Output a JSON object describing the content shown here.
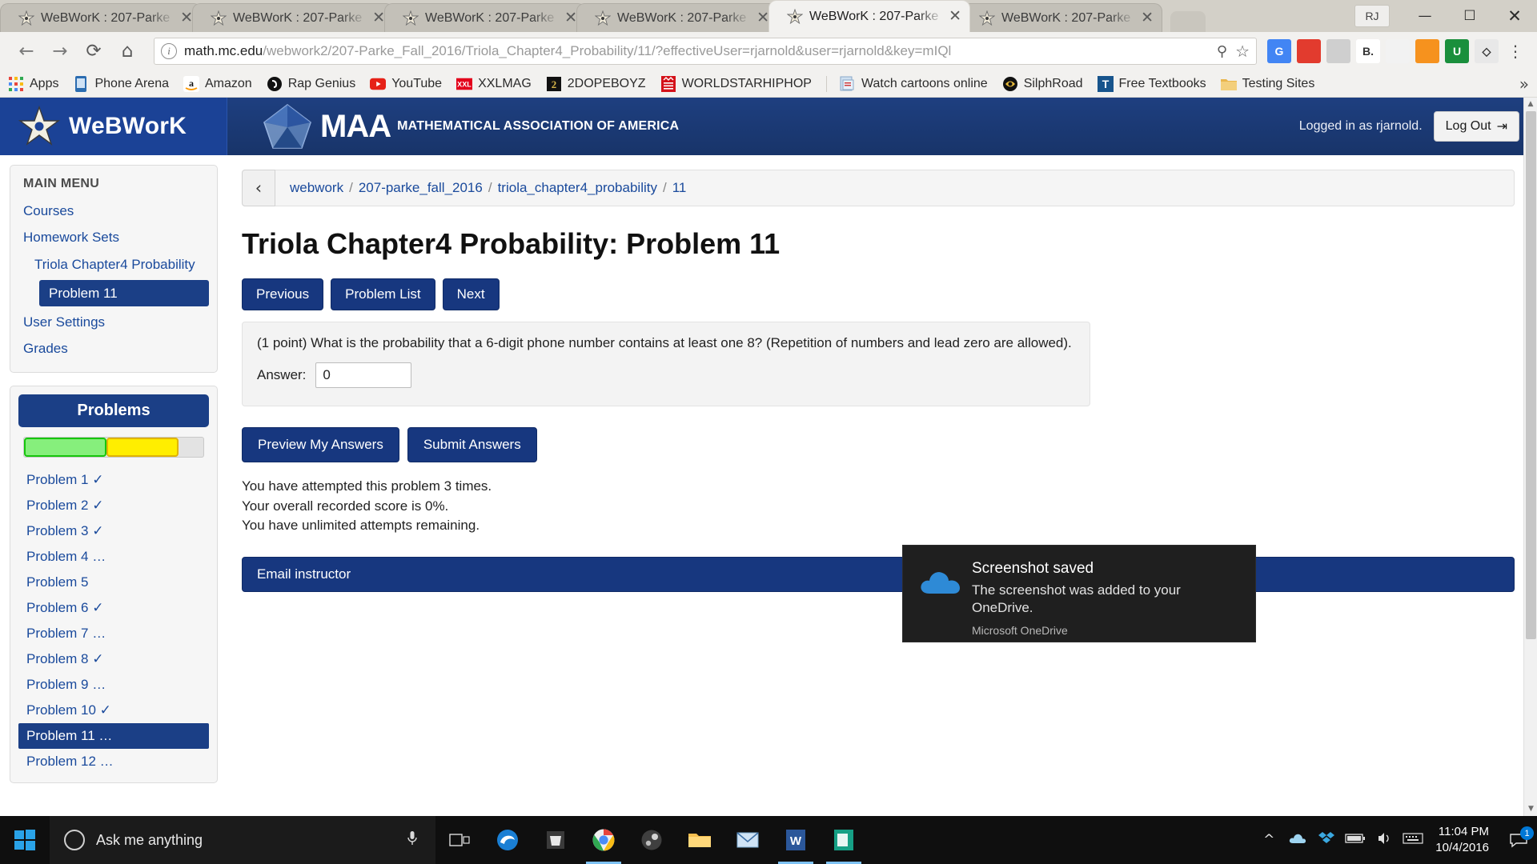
{
  "browser": {
    "tabs": [
      {
        "title": "WeBWorK : 207-Parke",
        "active": false
      },
      {
        "title": "WeBWorK : 207-Parke",
        "active": false
      },
      {
        "title": "WeBWorK : 207-Parke",
        "active": false
      },
      {
        "title": "WeBWorK : 207-Parke",
        "active": false
      },
      {
        "title": "WeBWorK : 207-Parke",
        "active": true
      },
      {
        "title": "WeBWorK : 207-Parke",
        "active": false
      }
    ],
    "close_glyph": "✕",
    "nav": {
      "back": "←",
      "forward": "→",
      "reload": "⟳",
      "home": "⌂"
    },
    "omnibox": {
      "host": "math.mc.edu",
      "path": "/webwork2/207-Parke_Fall_2016/Triola_Chapter4_Probability/11/?effectiveUser=rjarnold&user=rjarnold&key=mIQl",
      "info_glyph": "i",
      "zoom_glyph": "⚲",
      "star_glyph": "☆"
    },
    "extensions": [
      {
        "name": "google-translate-extension",
        "label": "G",
        "color": "#4285f4"
      },
      {
        "name": "adblock-extension",
        "label": "",
        "color": "#e23b2e"
      },
      {
        "name": "grey-extension",
        "label": "",
        "color": "#cfcfcf"
      },
      {
        "name": "bitly-extension",
        "label": "B.",
        "color": "#ffffff"
      },
      {
        "name": "pocket-extension",
        "label": "",
        "color": "#f2f2f2"
      },
      {
        "name": "orange-extension",
        "label": "",
        "color": "#f6921e"
      },
      {
        "name": "u-extension",
        "label": "U",
        "color": "#1a8f3c"
      },
      {
        "name": "shield-extension",
        "label": "◇",
        "color": "#e8e8e8"
      }
    ],
    "menu_glyph": "⋮",
    "window": {
      "avatar": "RJ",
      "minimize": "—",
      "maximize": "☐",
      "close": "✕"
    },
    "bookmarks": [
      {
        "label": "Apps",
        "icon": "apps-grid-icon",
        "color": "#4285f4"
      },
      {
        "label": "Phone Arena",
        "icon": "phone-arena-icon",
        "color": "#2b6cb0"
      },
      {
        "label": "Amazon",
        "icon": "amazon-icon",
        "color": "#ffffff"
      },
      {
        "label": "Rap Genius",
        "icon": "rap-genius-icon",
        "color": "#1a1a1a"
      },
      {
        "label": "YouTube",
        "icon": "youtube-icon",
        "color": "#e62117"
      },
      {
        "label": "XXLMAG",
        "icon": "xxl-icon",
        "color": "#e3001b"
      },
      {
        "label": "2DOPEBOYZ",
        "icon": "twodopeboyz-icon",
        "color": "#111111"
      },
      {
        "label": "WORLDSTARHIPHOP",
        "icon": "worldstar-icon",
        "color": "#d4121a"
      },
      {
        "label": "Watch cartoons online",
        "icon": "watch-cartoons-icon",
        "color": "#9db7d4"
      },
      {
        "label": "SilphRoad",
        "icon": "silphroad-icon",
        "color": "#1a1a1a"
      },
      {
        "label": "Free Textbooks",
        "icon": "free-textbooks-icon",
        "color": "#17548c"
      },
      {
        "label": "Testing Sites",
        "icon": "folder-icon",
        "color": "#e9b64d"
      }
    ],
    "bookmarks_overflow": "»"
  },
  "webwork": {
    "brand": "WeBWorK",
    "maa_title": "MAA",
    "maa_subtitle": "MATHEMATICAL ASSOCIATION OF AMERICA",
    "logged_in_as": "Logged in as rjarnold.",
    "logout_label": "Log Out",
    "logout_glyph": "⇥",
    "sidebar": {
      "main_menu_heading": "MAIN MENU",
      "items": [
        {
          "label": "Courses",
          "level": 0,
          "active": false
        },
        {
          "label": "Homework Sets",
          "level": 0,
          "active": false
        },
        {
          "label": "Triola Chapter4 Probability",
          "level": 1,
          "active": false
        },
        {
          "label": "Problem 11",
          "level": 2,
          "active": true
        },
        {
          "label": "User Settings",
          "level": 0,
          "active": false
        },
        {
          "label": "Grades",
          "level": 0,
          "active": false
        }
      ],
      "problems_heading": "Problems",
      "progress": {
        "green_pct": 46,
        "yellow_pct": 40,
        "empty_pct": 14
      },
      "problems": [
        {
          "label": "Problem 1 ✓",
          "active": false
        },
        {
          "label": "Problem 2 ✓",
          "active": false
        },
        {
          "label": "Problem 3 ✓",
          "active": false
        },
        {
          "label": "Problem 4 …",
          "active": false
        },
        {
          "label": "Problem 5",
          "active": false
        },
        {
          "label": "Problem 6 ✓",
          "active": false
        },
        {
          "label": "Problem 7 …",
          "active": false
        },
        {
          "label": "Problem 8 ✓",
          "active": false
        },
        {
          "label": "Problem 9 …",
          "active": false
        },
        {
          "label": "Problem 10 ✓",
          "active": false
        },
        {
          "label": "Problem 11 …",
          "active": true
        },
        {
          "label": "Problem 12 …",
          "active": false
        }
      ]
    },
    "breadcrumb": {
      "back_glyph": "‹",
      "crumbs": [
        "webwork",
        "207-parke_fall_2016",
        "triola_chapter4_probability",
        "11"
      ],
      "separator": "/"
    },
    "page_title": "Triola Chapter4 Probability: Problem 11",
    "nav_buttons": [
      "Previous",
      "Problem List",
      "Next"
    ],
    "problem": {
      "text": "(1 point) What is the probability that a 6-digit phone number contains at least one 8? (Repetition of numbers and lead zero are allowed).",
      "answer_label": "Answer:",
      "answer_value": "0"
    },
    "action_buttons": [
      "Preview My Answers",
      "Submit Answers"
    ],
    "status_lines": [
      "You have attempted this problem 3 times.",
      "Your overall recorded score is 0%.",
      "You have unlimited attempts remaining."
    ],
    "email_button": "Email instructor"
  },
  "toast": {
    "title": "Screenshot saved",
    "message": "The screenshot was added to your OneDrive.",
    "app": "Microsoft OneDrive"
  },
  "taskbar": {
    "cortana_placeholder": "Ask me anything",
    "cortana_mic": "ᵓ",
    "cortana_task": "▣",
    "items": [
      {
        "name": "edge",
        "active": false
      },
      {
        "name": "store",
        "active": false
      },
      {
        "name": "chrome",
        "active": true
      },
      {
        "name": "steam",
        "active": false
      },
      {
        "name": "file-explorer",
        "active": false
      },
      {
        "name": "mail",
        "active": false
      },
      {
        "name": "word",
        "active": true
      },
      {
        "name": "onenote",
        "active": true
      }
    ],
    "tray": [
      "˄",
      "☁",
      "⚙",
      "▭",
      "♪",
      "⌨"
    ],
    "time": "11:04 PM",
    "date": "10/4/2016",
    "notification_count": "1"
  },
  "colors": {
    "ww_blue": "#17377f",
    "ww_header": "#1b4296",
    "link_blue": "#1a4a9c",
    "progress_green": "#86ef7c",
    "progress_yellow": "#ffee00"
  }
}
